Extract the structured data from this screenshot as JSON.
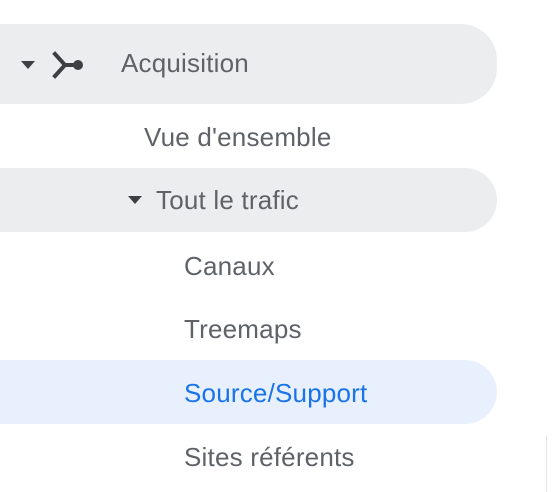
{
  "nav": {
    "acquisition": {
      "label": "Acquisition",
      "icon": "acquisition-branch-icon",
      "expanded": true
    },
    "overview": {
      "label": "Vue d'ensemble"
    },
    "all_traffic": {
      "label": "Tout le trafic",
      "expanded": true,
      "items": [
        {
          "label": "Canaux",
          "selected": false
        },
        {
          "label": "Treemaps",
          "selected": false
        },
        {
          "label": "Source/Support",
          "selected": true
        },
        {
          "label": "Sites référents",
          "selected": false
        }
      ]
    }
  },
  "colors": {
    "section_background": "#ecedef",
    "selected_background": "#e8f0fe",
    "selected_text": "#1a73e8",
    "text": "#5f6368",
    "icon": "#3c4043"
  }
}
